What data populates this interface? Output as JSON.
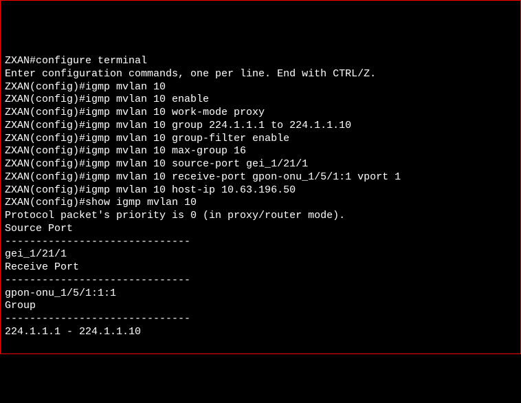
{
  "lines": [
    "ZXAN#configure terminal",
    "Enter configuration commands, one per line. End with CTRL/Z.",
    "ZXAN(config)#igmp mvlan 10",
    "ZXAN(config)#igmp mvlan 10 enable",
    "ZXAN(config)#igmp mvlan 10 work-mode proxy",
    "ZXAN(config)#igmp mvlan 10 group 224.1.1.1 to 224.1.1.10",
    "ZXAN(config)#igmp mvlan 10 group-filter enable",
    "ZXAN(config)#igmp mvlan 10 max-group 16",
    "ZXAN(config)#igmp mvlan 10 source-port gei_1/21/1",
    "ZXAN(config)#igmp mvlan 10 receive-port gpon-onu_1/5/1:1 vport 1",
    "ZXAN(config)#igmp mvlan 10 host-ip 10.63.196.50",
    "ZXAN(config)#show igmp mvlan 10",
    "Protocol packet's priority is 0 (in proxy/router mode).",
    "Source Port",
    "------------------------------",
    "gei_1/21/1",
    "",
    "Receive Port",
    "------------------------------",
    "gpon-onu_1/5/1:1:1",
    "",
    "Group",
    "------------------------------",
    "224.1.1.1 - 224.1.1.10",
    ""
  ]
}
